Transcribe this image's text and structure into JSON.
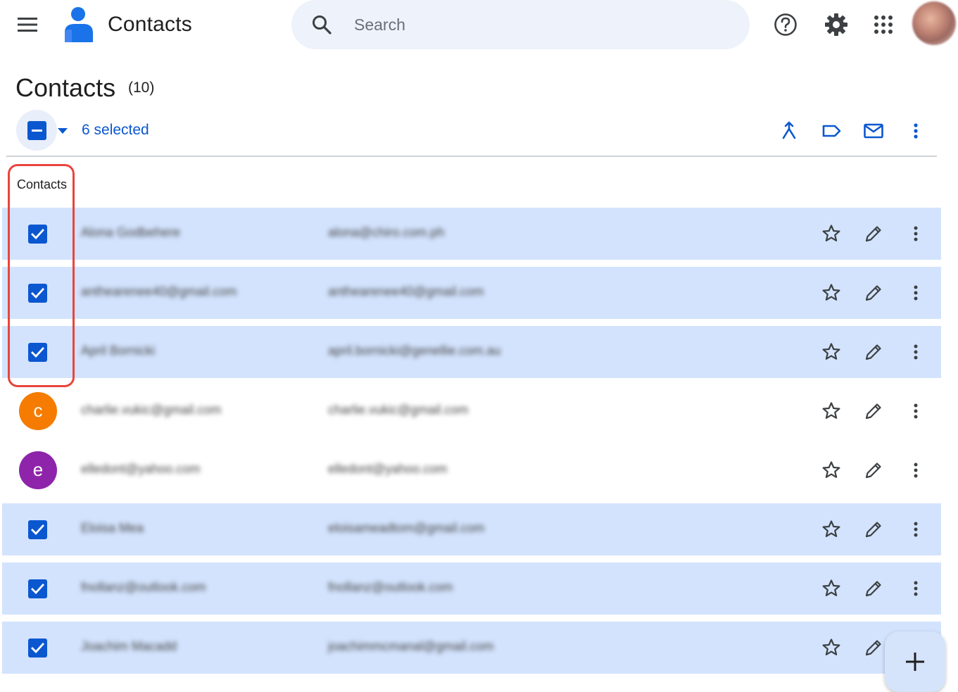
{
  "header": {
    "app_title": "Contacts",
    "search_placeholder": "Search",
    "icons": [
      "menu-icon",
      "contacts-logo-icon",
      "search-icon",
      "help-icon",
      "settings-gear-icon",
      "apps-grid-icon",
      "account-avatar"
    ]
  },
  "page": {
    "title": "Contacts",
    "count": "(10)"
  },
  "selection_toolbar": {
    "selected_text": "6 selected",
    "actions": [
      "merge-icon",
      "label-icon",
      "email-icon",
      "more-vert-icon"
    ]
  },
  "section": {
    "label": "Contacts"
  },
  "contacts": [
    {
      "name": "Alona Godbehere",
      "email": "alona@chiro.com.ph",
      "selected": true
    },
    {
      "name": "anthearenee40@gmail.com",
      "email": "anthearenee40@gmail.com",
      "selected": true
    },
    {
      "name": "April Bornicki",
      "email": "april.bornicki@genellie.com.au",
      "selected": true
    },
    {
      "name": "charlie.vukic@gmail.com",
      "email": "charlie.vukic@gmail.com",
      "selected": false,
      "avatar_letter": "c",
      "avatar_color": "#f57c00"
    },
    {
      "name": "elledont@yahoo.com",
      "email": "elledont@yahoo.com",
      "selected": false,
      "avatar_letter": "e",
      "avatar_color": "#8e24aa"
    },
    {
      "name": "Eloisa Mea",
      "email": "eloisameadtom@gmail.com",
      "selected": true
    },
    {
      "name": "fnollanz@outlook.com",
      "email": "fnollanz@outlook.com",
      "selected": true
    },
    {
      "name": "Joachim Macadd",
      "email": "joachimmcmanal@gmail.com",
      "selected": true
    }
  ],
  "colors": {
    "accent": "#0b57d0",
    "selected_row": "#d3e3fd",
    "highlight_border": "#e8453c"
  },
  "fab": {
    "icon": "plus-icon"
  }
}
